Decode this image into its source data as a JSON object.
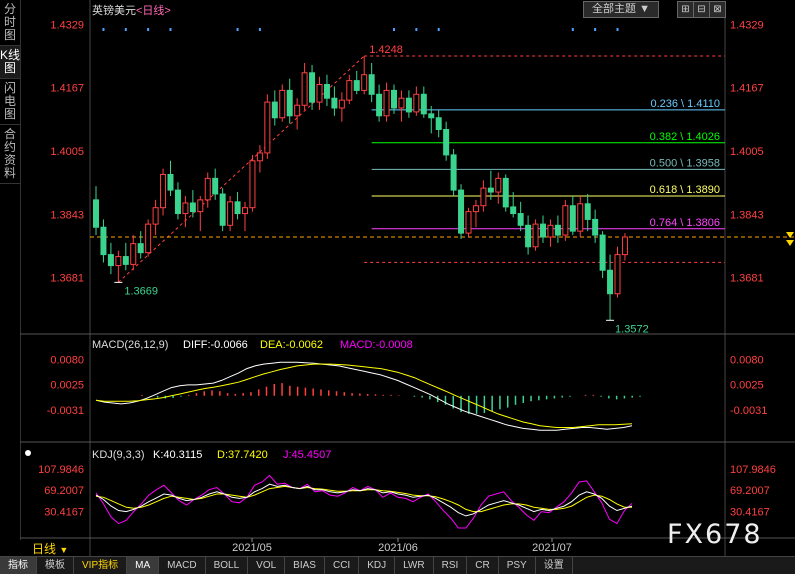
{
  "side_tabs": [
    {
      "label": "分时图",
      "active": false
    },
    {
      "label": "K线图",
      "active": true
    },
    {
      "label": "闪电图",
      "active": false
    },
    {
      "label": "合约资料",
      "active": false
    }
  ],
  "header": {
    "symbol": "英镑美元",
    "period_tag": "<日线>",
    "selector": "全部主题",
    "icons": [
      "▼",
      "⊞",
      "⊟",
      "⊠"
    ]
  },
  "colors": {
    "up": "#ff4040",
    "down": "#3ad48f",
    "diff": "#ffffff",
    "dea": "#ffff00",
    "kdj_k": "#ffffff",
    "kdj_d": "#ffff00",
    "kdj_j": "#ff00ff",
    "price_axis": "#ff4040",
    "sub_axis": "#ff4040"
  },
  "price_axis": [
    "1.4329",
    "1.4167",
    "1.4005",
    "1.3843",
    "1.3681"
  ],
  "price_labels": {
    "high": "1.4248",
    "low1": "1.3669",
    "low2": "1.3572"
  },
  "fib_levels": [
    {
      "label": "0.236 \\ 1.4110",
      "value": 1.411,
      "color": "#66ccff"
    },
    {
      "label": "0.382 \\ 1.4026",
      "value": 1.4026,
      "color": "#00ff00"
    },
    {
      "label": "0.500 \\ 1.3958",
      "value": 1.3958,
      "color": "#77bbbb"
    },
    {
      "label": "0.618 \\ 1.3890",
      "value": 1.389,
      "color": "#ffff66"
    },
    {
      "label": "0.764 \\ 1.3806",
      "value": 1.3806,
      "color": "#ff44ff"
    }
  ],
  "macd": {
    "title": "MACD(26,12,9)",
    "diff_label": "DIFF:-0.0066",
    "dea_label": "DEA:-0.0062",
    "macd_label": "MACD:-0.0008",
    "axis": [
      "0.0080",
      "0.0025",
      "-0.0031"
    ]
  },
  "kdj": {
    "title": "KDJ(9,3,3)",
    "k_label": "K:40.3115",
    "d_label": "D:37.7420",
    "j_label": "J:45.4507",
    "axis": [
      "107.9846",
      "69.2007",
      "30.4167"
    ]
  },
  "x_labels": [
    "2021/05",
    "2021/06",
    "2021/07"
  ],
  "period_label": "日线",
  "bottom_tabs": [
    {
      "label": "指标",
      "on": true
    },
    {
      "label": "模板",
      "on": false
    },
    {
      "label": "VIP指标",
      "on": false,
      "vip": true
    },
    {
      "label": "MA",
      "on": true
    },
    {
      "label": "MACD",
      "on": false
    },
    {
      "label": "BOLL",
      "on": false
    },
    {
      "label": "VOL",
      "on": false
    },
    {
      "label": "BIAS",
      "on": false
    },
    {
      "label": "CCI",
      "on": false
    },
    {
      "label": "KDJ",
      "on": false
    },
    {
      "label": "LWR",
      "on": false
    },
    {
      "label": "RSI",
      "on": false
    },
    {
      "label": "CR",
      "on": false
    },
    {
      "label": "PSY",
      "on": false
    },
    {
      "label": "设置",
      "on": false
    }
  ],
  "watermark": "FX678",
  "chart_data": {
    "type": "candlestick",
    "title": "英镑美元<日线>",
    "x_labels": [
      "2021/05",
      "2021/06",
      "2021/07"
    ],
    "ylim": [
      1.356,
      1.434
    ],
    "candles": [
      [
        1.388,
        1.3915,
        1.379,
        1.381
      ],
      [
        1.381,
        1.383,
        1.372,
        1.374
      ],
      [
        1.374,
        1.377,
        1.369,
        1.3712
      ],
      [
        1.3712,
        1.375,
        1.3669,
        1.3735
      ],
      [
        1.3735,
        1.377,
        1.37,
        1.3715
      ],
      [
        1.3715,
        1.379,
        1.37,
        1.3768
      ],
      [
        1.3768,
        1.38,
        1.373,
        1.3745
      ],
      [
        1.3745,
        1.383,
        1.3735,
        1.3818
      ],
      [
        1.3818,
        1.388,
        1.379,
        1.386
      ],
      [
        1.386,
        1.396,
        1.384,
        1.3945
      ],
      [
        1.3945,
        1.398,
        1.389,
        1.3905
      ],
      [
        1.3905,
        1.3925,
        1.383,
        1.3845
      ],
      [
        1.3845,
        1.389,
        1.381,
        1.3872
      ],
      [
        1.3872,
        1.3905,
        1.3835,
        1.385
      ],
      [
        1.385,
        1.389,
        1.38,
        1.388
      ],
      [
        1.388,
        1.395,
        1.386,
        1.3935
      ],
      [
        1.3935,
        1.396,
        1.388,
        1.3895
      ],
      [
        1.3895,
        1.391,
        1.38,
        1.3815
      ],
      [
        1.3815,
        1.389,
        1.38,
        1.3875
      ],
      [
        1.3875,
        1.39,
        1.383,
        1.3845
      ],
      [
        1.3845,
        1.3875,
        1.38,
        1.386
      ],
      [
        1.386,
        1.3995,
        1.385,
        1.398
      ],
      [
        1.398,
        1.402,
        1.395,
        1.4
      ],
      [
        1.4,
        1.415,
        1.3985,
        1.413
      ],
      [
        1.413,
        1.416,
        1.407,
        1.409
      ],
      [
        1.409,
        1.4175,
        1.408,
        1.416
      ],
      [
        1.416,
        1.419,
        1.4075,
        1.4095
      ],
      [
        1.4095,
        1.414,
        1.406,
        1.4122
      ],
      [
        1.4122,
        1.423,
        1.411,
        1.4205
      ],
      [
        1.4205,
        1.4225,
        1.411,
        1.413
      ],
      [
        1.413,
        1.4195,
        1.411,
        1.4175
      ],
      [
        1.4175,
        1.42,
        1.412,
        1.414
      ],
      [
        1.414,
        1.417,
        1.4095,
        1.4115
      ],
      [
        1.4115,
        1.4155,
        1.408,
        1.4135
      ],
      [
        1.4135,
        1.42,
        1.4125,
        1.4185
      ],
      [
        1.4185,
        1.421,
        1.415,
        1.416
      ],
      [
        1.416,
        1.4248,
        1.415,
        1.42
      ],
      [
        1.42,
        1.423,
        1.413,
        1.415
      ],
      [
        1.415,
        1.4175,
        1.408,
        1.4095
      ],
      [
        1.4095,
        1.418,
        1.408,
        1.416
      ],
      [
        1.416,
        1.4175,
        1.41,
        1.4115
      ],
      [
        1.4115,
        1.416,
        1.408,
        1.414
      ],
      [
        1.414,
        1.416,
        1.409,
        1.4105
      ],
      [
        1.4105,
        1.417,
        1.4095,
        1.415
      ],
      [
        1.415,
        1.417,
        1.409,
        1.41
      ],
      [
        1.41,
        1.412,
        1.405,
        1.409
      ],
      [
        1.409,
        1.411,
        1.404,
        1.406
      ],
      [
        1.406,
        1.408,
        1.398,
        1.3995
      ],
      [
        1.3995,
        1.401,
        1.389,
        1.3905
      ],
      [
        1.3905,
        1.392,
        1.378,
        1.3795
      ],
      [
        1.3795,
        1.386,
        1.3785,
        1.385
      ],
      [
        1.385,
        1.388,
        1.381,
        1.3865
      ],
      [
        1.3865,
        1.393,
        1.385,
        1.391
      ],
      [
        1.391,
        1.3955,
        1.388,
        1.39
      ],
      [
        1.39,
        1.395,
        1.387,
        1.3935
      ],
      [
        1.3935,
        1.3945,
        1.385,
        1.3862
      ],
      [
        1.3862,
        1.39,
        1.3835,
        1.3845
      ],
      [
        1.3845,
        1.3875,
        1.38,
        1.3815
      ],
      [
        1.3815,
        1.384,
        1.374,
        1.376
      ],
      [
        1.376,
        1.383,
        1.375,
        1.3818
      ],
      [
        1.3818,
        1.384,
        1.377,
        1.3785
      ],
      [
        1.3785,
        1.383,
        1.376,
        1.3815
      ],
      [
        1.3815,
        1.384,
        1.377,
        1.379
      ],
      [
        1.379,
        1.388,
        1.3775,
        1.3865
      ],
      [
        1.3865,
        1.389,
        1.379,
        1.38
      ],
      [
        1.38,
        1.389,
        1.3785,
        1.387
      ],
      [
        1.387,
        1.3895,
        1.38,
        1.383
      ],
      [
        1.383,
        1.3855,
        1.377,
        1.379
      ],
      [
        1.379,
        1.38,
        1.368,
        1.37
      ],
      [
        1.37,
        1.374,
        1.3572,
        1.364
      ],
      [
        1.364,
        1.376,
        1.363,
        1.374
      ],
      [
        1.374,
        1.3795,
        1.3725,
        1.3785
      ]
    ],
    "macd_hist": [
      0.0002,
      0.0,
      -0.0004,
      -0.0006,
      -0.0005,
      -0.0002,
      0.0002,
      0.0006,
      0.001,
      0.0012,
      0.001,
      0.0006,
      0.0004,
      0.0006,
      0.0008,
      0.0014,
      0.002,
      0.0026,
      0.0028,
      0.0022,
      0.002,
      0.0018,
      0.0016,
      0.0014,
      0.0012,
      0.001,
      0.0008,
      0.0006,
      0.0005,
      0.0004,
      0.0003,
      0.0002,
      0.0002,
      0.0001,
      0.0,
      -0.0002,
      -0.0004,
      -0.0008,
      -0.0014,
      -0.002,
      -0.0028,
      -0.0036,
      -0.004,
      -0.004,
      -0.0038,
      -0.0034,
      -0.003,
      -0.0026,
      -0.002,
      -0.0016,
      -0.0012,
      -0.001,
      -0.0008,
      -0.0006,
      -0.0004,
      -0.0002,
      0.0,
      0.0002,
      0.0002,
      -0.0002,
      -0.0006,
      -0.0008,
      -0.0006,
      -0.0004,
      -0.0002
    ],
    "macd_diff": [
      -0.001,
      -0.0014,
      -0.0016,
      -0.0018,
      -0.0016,
      -0.0012,
      -0.0006,
      0.0002,
      0.001,
      0.0018,
      0.0022,
      0.0024,
      0.0024,
      0.0026,
      0.0028,
      0.0034,
      0.0042,
      0.005,
      0.006,
      0.0066,
      0.007,
      0.0072,
      0.0074,
      0.0074,
      0.0074,
      0.0073,
      0.0072,
      0.007,
      0.0068,
      0.0066,
      0.0062,
      0.0058,
      0.0054,
      0.005,
      0.0046,
      0.004,
      0.0034,
      0.0026,
      0.0018,
      0.001,
      0.0002,
      -0.0008,
      -0.0018,
      -0.0026,
      -0.0034,
      -0.004,
      -0.0046,
      -0.0052,
      -0.0058,
      -0.0064,
      -0.0068,
      -0.0072,
      -0.0074,
      -0.0076,
      -0.0076,
      -0.0076,
      -0.0074,
      -0.0072,
      -0.007,
      -0.007,
      -0.0072,
      -0.0074,
      -0.0072,
      -0.007,
      -0.0066
    ],
    "macd_dea": [
      -0.001,
      -0.0012,
      -0.0012,
      -0.0012,
      -0.0012,
      -0.0011,
      -0.0009,
      -0.0007,
      -0.0004,
      0.0,
      0.0004,
      0.0008,
      0.0012,
      0.0016,
      0.0019,
      0.0022,
      0.0026,
      0.003,
      0.0036,
      0.0042,
      0.0048,
      0.0053,
      0.0058,
      0.0062,
      0.0066,
      0.0068,
      0.007,
      0.007,
      0.007,
      0.0069,
      0.0068,
      0.0066,
      0.0064,
      0.0062,
      0.006,
      0.0056,
      0.0052,
      0.0046,
      0.004,
      0.0032,
      0.0024,
      0.0016,
      0.0008,
      0.0,
      -0.0008,
      -0.0016,
      -0.0024,
      -0.0032,
      -0.004,
      -0.0046,
      -0.0052,
      -0.0058,
      -0.0062,
      -0.0066,
      -0.0068,
      -0.007,
      -0.007,
      -0.007,
      -0.0068,
      -0.0066,
      -0.0064,
      -0.0064,
      -0.0064,
      -0.0063,
      -0.0062
    ],
    "kdj_k": [
      60,
      52,
      40,
      32,
      30,
      34,
      40,
      48,
      55,
      62,
      60,
      54,
      50,
      52,
      56,
      62,
      66,
      62,
      56,
      54,
      56,
      66,
      72,
      80,
      76,
      78,
      74,
      72,
      76,
      70,
      70,
      66,
      64,
      66,
      70,
      68,
      72,
      70,
      64,
      66,
      62,
      60,
      56,
      58,
      60,
      54,
      46,
      38,
      28,
      22,
      26,
      34,
      42,
      46,
      50,
      46,
      42,
      36,
      30,
      34,
      32,
      36,
      40,
      48,
      60,
      66,
      62,
      54,
      40,
      32,
      36,
      40
    ],
    "kdj_d": [
      58,
      56,
      50,
      44,
      38,
      36,
      38,
      42,
      48,
      54,
      58,
      56,
      54,
      52,
      54,
      58,
      62,
      62,
      60,
      58,
      56,
      60,
      66,
      72,
      74,
      76,
      74,
      72,
      74,
      72,
      71,
      69,
      67,
      67,
      68,
      68,
      70,
      70,
      68,
      67,
      65,
      63,
      60,
      59,
      59,
      57,
      53,
      48,
      42,
      34,
      30,
      30,
      34,
      38,
      42,
      44,
      44,
      42,
      38,
      36,
      34,
      34,
      36,
      40,
      48,
      56,
      60,
      58,
      52,
      44,
      38,
      38
    ],
    "kdj_j": [
      64,
      44,
      20,
      8,
      14,
      30,
      44,
      60,
      70,
      78,
      64,
      50,
      42,
      52,
      60,
      70,
      74,
      62,
      48,
      46,
      56,
      78,
      84,
      96,
      80,
      82,
      74,
      72,
      80,
      66,
      68,
      60,
      58,
      64,
      74,
      68,
      76,
      70,
      56,
      64,
      56,
      54,
      48,
      56,
      62,
      48,
      32,
      18,
      0,
      0,
      18,
      42,
      58,
      62,
      66,
      50,
      38,
      24,
      14,
      30,
      28,
      38,
      48,
      64,
      84,
      86,
      66,
      46,
      16,
      8,
      32,
      45
    ]
  }
}
